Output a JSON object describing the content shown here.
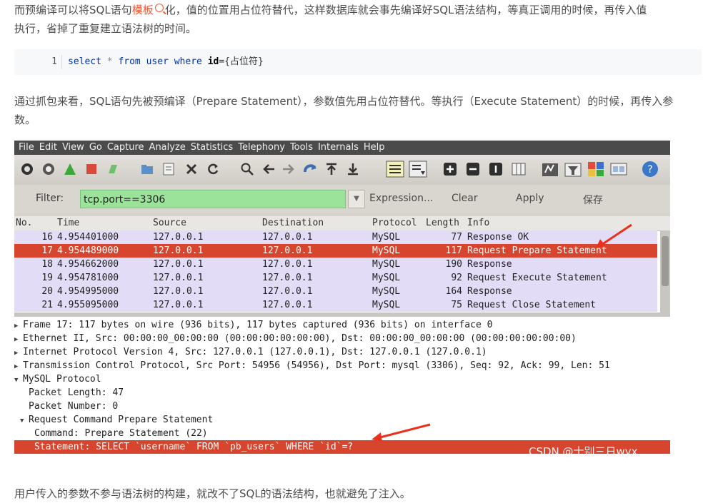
{
  "article": {
    "intro_a": "而预编译可以将SQL语句",
    "intro_link": "模板",
    "intro_b": "化，值的位置用占位符替代，这样数据库就会事先编译好SQL语法结构，等真正调用的时候，再传入值",
    "intro_c": "执行，省掉了重复建立语法树的时间。",
    "code_line_no": "1",
    "code": {
      "kw1": "select",
      "op": "*",
      "kw2": "from",
      "kw3": "user",
      "kw4": "where",
      "id": "id",
      "rest": "={占位符}"
    },
    "para2_a": "通过抓包来看，SQL语句先被预编译（Prepare Statement），参数值先用占位符替代。等执行（Execute Statement）的时候，再传入参",
    "para2_b": "数。",
    "para3": "用户传入的参数不参与语法树的构建，就改不了SQL的语法结构，也就避免了注入。"
  },
  "wireshark": {
    "menu": [
      "File",
      "Edit",
      "View",
      "Go",
      "Capture",
      "Analyze",
      "Statistics",
      "Telephony",
      "Tools",
      "Internals",
      "Help"
    ],
    "filter": {
      "label": "Filter:",
      "value": "tcp.port==3306",
      "expression": "Expression...",
      "clear": "Clear",
      "apply": "Apply",
      "save": "保存"
    },
    "columns": {
      "no": "No.",
      "time": "Time",
      "source": "Source",
      "destination": "Destination",
      "protocol": "Protocol",
      "length": "Length",
      "info": "Info"
    },
    "packets": [
      {
        "no": "16",
        "time": "4.954401000",
        "src": "127.0.0.1",
        "dst": "127.0.0.1",
        "proto": "MySQL",
        "len": "77",
        "info": "Response OK"
      },
      {
        "no": "17",
        "time": "4.954489000",
        "src": "127.0.0.1",
        "dst": "127.0.0.1",
        "proto": "MySQL",
        "len": "117",
        "info": "Request Prepare Statement"
      },
      {
        "no": "18",
        "time": "4.954662000",
        "src": "127.0.0.1",
        "dst": "127.0.0.1",
        "proto": "MySQL",
        "len": "190",
        "info": "Response"
      },
      {
        "no": "19",
        "time": "4.954781000",
        "src": "127.0.0.1",
        "dst": "127.0.0.1",
        "proto": "MySQL",
        "len": "92",
        "info": "Request Execute Statement"
      },
      {
        "no": "20",
        "time": "4.954995000",
        "src": "127.0.0.1",
        "dst": "127.0.0.1",
        "proto": "MySQL",
        "len": "164",
        "info": "Response"
      },
      {
        "no": "21",
        "time": "4.955095000",
        "src": "127.0.0.1",
        "dst": "127.0.0.1",
        "proto": "MySQL",
        "len": "75",
        "info": "Request Close Statement"
      }
    ],
    "details": [
      "Frame 17: 117 bytes on wire (936 bits), 117 bytes captured (936 bits) on interface 0",
      "Ethernet II, Src: 00:00:00_00:00:00 (00:00:00:00:00:00), Dst: 00:00:00_00:00:00 (00:00:00:00:00:00)",
      "Internet Protocol Version 4, Src: 127.0.0.1 (127.0.0.1), Dst: 127.0.0.1 (127.0.0.1)",
      "Transmission Control Protocol, Src Port: 54956 (54956), Dst Port: mysql (3306), Seq: 92, Ack: 99, Len: 51",
      "MySQL Protocol",
      "Packet Length: 47",
      "Packet Number: 0",
      "Request Command Prepare Statement",
      "Command: Prepare Statement (22)",
      "Statement: SELECT `username` FROM `pb_users` WHERE `id`=?"
    ],
    "watermark": "CSDN @士别三日wyx",
    "colors": {
      "selected": "#d7452f",
      "row": "#e2dcf7",
      "filter_ok": "#9be39b",
      "arrow": "#e8321e"
    }
  }
}
